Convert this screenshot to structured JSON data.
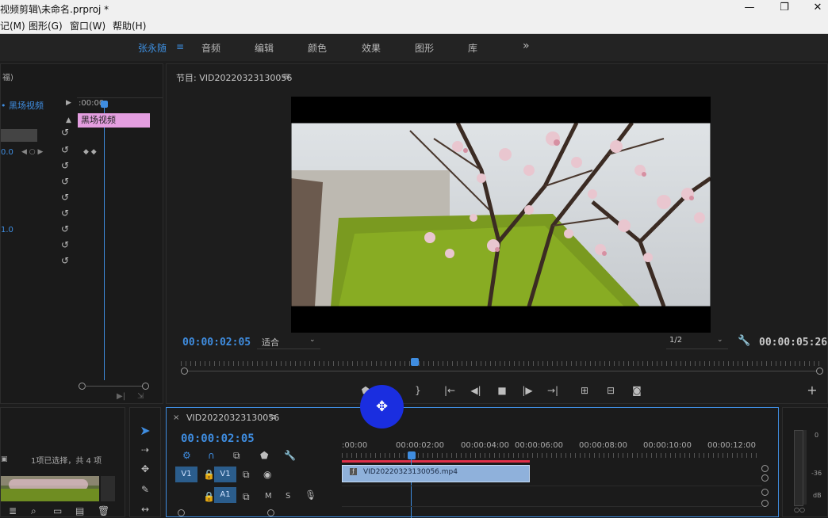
{
  "window": {
    "title": "视频剪辑\\未命名.prproj *",
    "controls": [
      "minimize-icon",
      "restore-icon",
      "close-icon"
    ]
  },
  "menu": {
    "items": [
      "记(M)",
      "图形(G)",
      "窗口(W)",
      "帮助(H)"
    ]
  },
  "workspaces": {
    "active": "张永随",
    "items": [
      "音频",
      "编辑",
      "颜色",
      "效果",
      "图形",
      "库"
    ],
    "more": "»"
  },
  "effect_controls": {
    "header": "福)",
    "clip_name": "黑场视频",
    "time_start": ":00:00",
    "value_a": "0.0",
    "value_b": "1.0",
    "clip_bar_label": "黑场视频"
  },
  "program_monitor": {
    "title": "节目: VID20220323130056",
    "current_time": "00:00:02:05",
    "fit_label": "适合",
    "resolution": "1/2",
    "duration": "00:00:05:26"
  },
  "project_panel": {
    "selection_text": "1项已选择，共 4 项"
  },
  "timeline": {
    "sequence_name": "VID20220323130056",
    "current_time": "00:00:02:05",
    "ruler_labels": [
      ":00:00",
      "00:00:02:00",
      "00:00:04:00",
      "00:00:06:00",
      "00:00:08:00",
      "00:00:10:00",
      "00:00:12:00"
    ],
    "tracks": [
      {
        "source": "V1",
        "target": "V1",
        "kind": "video"
      },
      {
        "source": "",
        "target": "A1",
        "kind": "audio",
        "m": "M",
        "s": "S"
      }
    ],
    "clip_name": "VID20220323130056.mp4",
    "playhead_seconds": 2.17
  },
  "audio_meter": {
    "labels": [
      "0",
      "-36",
      "dB"
    ]
  },
  "colors": {
    "accent_blue": "#3f8de0",
    "clip_pink": "#e49ee0",
    "clip_blue": "#8fb1db",
    "cursor_blue": "#1a2ee0"
  }
}
